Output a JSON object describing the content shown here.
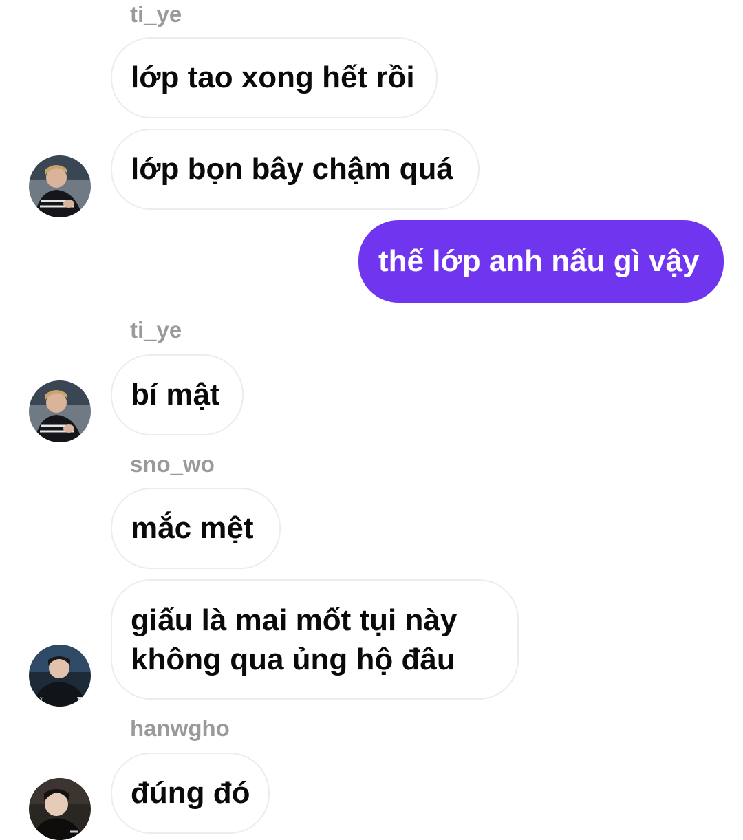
{
  "conversation": {
    "messages": [
      {
        "sender": "ti_ye",
        "text": "lớp tao xong hết rồi"
      },
      {
        "text": "lớp bọn bây chậm quá"
      },
      {
        "direction": "sent",
        "text": "thế lớp anh nấu gì vậy"
      },
      {
        "sender": "ti_ye",
        "text": "bí mật"
      },
      {
        "sender": "sno_wo",
        "text": "mắc mệt"
      },
      {
        "text_line1": "giấu là mai mốt tụi này",
        "text_line2": "không qua ủng hộ đâu"
      },
      {
        "sender": "hanwgho",
        "text": "đúng đó"
      }
    ]
  },
  "colors": {
    "sent_bubble": "#7035ee",
    "received_bubble_border": "#ececec",
    "sender_name": "#9a9a9a"
  }
}
